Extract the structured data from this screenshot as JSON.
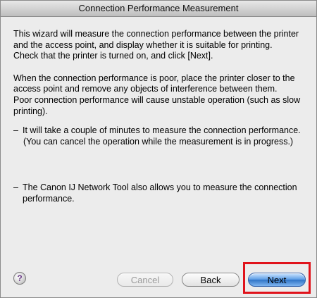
{
  "window": {
    "title": "Connection Performance Measurement"
  },
  "content": {
    "paragraph_1_line_1": "This wizard will measure the connection performance between the printer and the access point, and display whether it is suitable for printing.",
    "paragraph_1_line_2": "Check that the printer is turned on, and click [Next].",
    "paragraph_2_line_1": "When the connection performance is poor, place the printer closer to the access point and remove any objects of interference between them.",
    "paragraph_2_line_2": "Poor connection performance will cause unstable operation (such as slow printing).",
    "bullet_1": "It will take a couple of minutes to measure the connection performance.",
    "bullet_1_note": "(You can cancel the operation while the measurement is in progress.)",
    "bullet_2": "The Canon IJ Network Tool also allows you to measure the connection performance.",
    "bullet_mark": "–"
  },
  "buttons": {
    "help": "?",
    "cancel": "Cancel",
    "back": "Back",
    "next": "Next"
  },
  "colors": {
    "highlight": "#e0131b",
    "next_button": "#4a8fe0"
  },
  "icons": {
    "help": "help-icon"
  }
}
